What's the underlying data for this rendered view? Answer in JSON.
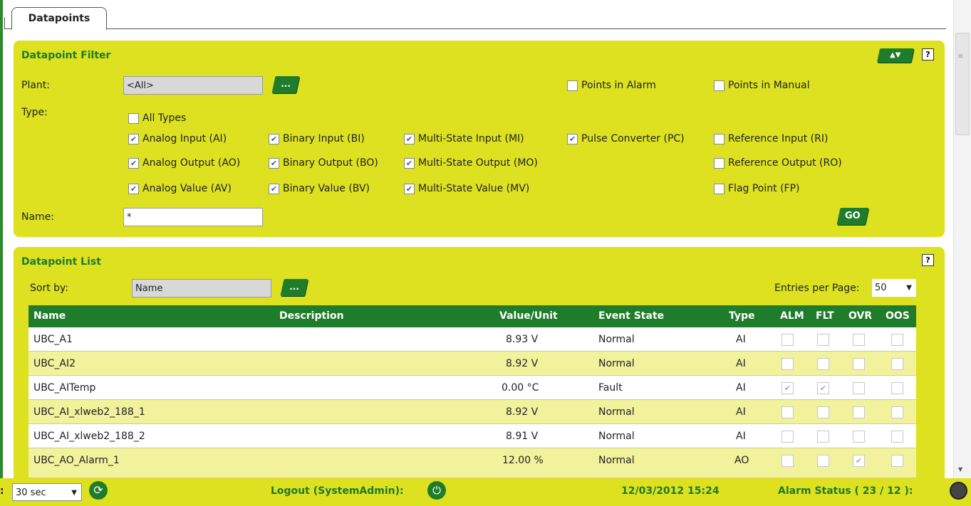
{
  "tab": {
    "label": "Datapoints"
  },
  "filter": {
    "title": "Datapoint Filter",
    "plant_label": "Plant:",
    "plant_value": "<All>",
    "browse_label": "...",
    "points_in_alarm": "Points in Alarm",
    "points_in_manual": "Points in Manual",
    "type_label": "Type:",
    "all_types": "All Types",
    "types": {
      "ai": "Analog Input (AI)",
      "ao": "Analog Output (AO)",
      "av": "Analog Value (AV)",
      "bi": "Binary Input (BI)",
      "bo": "Binary Output (BO)",
      "bv": "Binary Value (BV)",
      "mi": "Multi-State Input (MI)",
      "mo": "Multi-State Output (MO)",
      "mv": "Multi-State Value (MV)",
      "pc": "Pulse Converter (PC)",
      "ri": "Reference Input (RI)",
      "ro": "Reference Output (RO)",
      "fp": "Flag Point (FP)"
    },
    "name_label": "Name:",
    "name_value": "*",
    "go_label": "GO",
    "collapse_label": "▲▼",
    "help": "?"
  },
  "list": {
    "title": "Datapoint List",
    "help": "?",
    "sort_label": "Sort by:",
    "sort_value": "Name",
    "browse_label": "...",
    "entries_label": "Entries per Page:",
    "entries_value": "50",
    "columns": {
      "name": "Name",
      "description": "Description",
      "value": "Value/Unit",
      "event": "Event State",
      "type": "Type",
      "alm": "ALM",
      "flt": "FLT",
      "ovr": "OVR",
      "oos": "OOS"
    },
    "rows": [
      {
        "name": "UBC_A1",
        "value": "8.93 V",
        "event": "Normal",
        "type": "AI"
      },
      {
        "name": "UBC_AI2",
        "value": "8.92 V",
        "event": "Normal",
        "type": "AI"
      },
      {
        "name": "UBC_AITemp",
        "value": "0.00 °C",
        "event": "Fault",
        "type": "AI"
      },
      {
        "name": "UBC_AI_xlweb2_188_1",
        "value": "8.92 V",
        "event": "Normal",
        "type": "AI"
      },
      {
        "name": "UBC_AI_xlweb2_188_2",
        "value": "8.91 V",
        "event": "Normal",
        "type": "AI"
      },
      {
        "name": "UBC_AO_Alarm_1",
        "value": "12.00 %",
        "event": "Normal",
        "type": "AO"
      }
    ]
  },
  "statusbar": {
    "refresh_prefix": ":",
    "refresh_value": "30 sec",
    "logout": "Logout (SystemAdmin):",
    "datetime": "12/03/2012 15:24",
    "alarm_status": "Alarm Status ( 23 / 12 ):"
  },
  "colors": {
    "accent_green": "#1e7c2a",
    "panel_yellow": "#dde120",
    "row_alt": "#f1f29b"
  }
}
